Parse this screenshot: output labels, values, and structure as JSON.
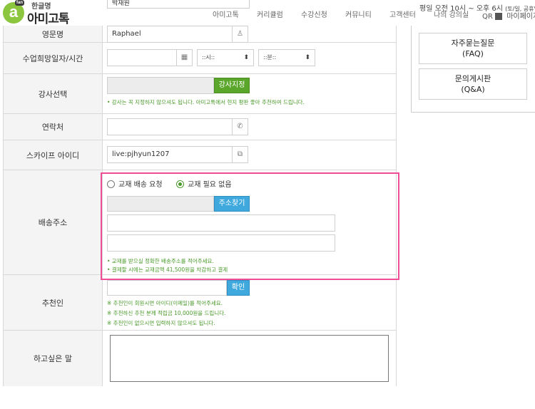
{
  "header": {
    "logo_small": "한글명",
    "logo_main": "아미고톡",
    "logo_badge": "fan",
    "top_name_value": "박재원",
    "nav": [
      "아미고톡",
      "커리큘럼",
      "수강신청",
      "커뮤니티",
      "고객센터",
      "나의 강의실"
    ],
    "hours": "평일 오전 10시 ~ 오후 6시",
    "hours_note": "(토/일, 공휴일 휴무)",
    "mypage": "마이페이지",
    "mypage_prefix": "QR"
  },
  "form": {
    "english_name": {
      "label": "영문명",
      "value": "Raphael",
      "icon": "person-icon"
    },
    "schedule": {
      "label": "수업희망일자/시간",
      "date_value": "",
      "hour_placeholder": "::시::",
      "minute_placeholder": "::분::"
    },
    "teacher": {
      "label": "강사선택",
      "value": "",
      "button": "강사지정",
      "note": "• 강사는 꼭 지정하지 않으셔도 됩니다. 아미고톡에서 현지 평판 좋아 추천하여 드립니다."
    },
    "contact": {
      "label": "연락처",
      "value": ""
    },
    "skype": {
      "label": "스카이프 아이디",
      "value": "live:pjhyun1207"
    },
    "shipping": {
      "label": "배송주소",
      "option_request": "교재 배송 요청",
      "option_none": "교재 필요 없음",
      "selected": "교재 필요 없음",
      "zip_value": "",
      "search_button": "주소찾기",
      "address1": "",
      "address2": "",
      "note1": "• 교재를 받으실 정확한 배송주소를 적어주세요.",
      "note2": "• 결제할 시에는 교재금액 41,500원을 차감하고 결제"
    },
    "referrer": {
      "label": "추천인",
      "value": "",
      "button": "확인",
      "note1": "※ 추천인이 회원시면 아이디(이메일)를 적어주세요.",
      "note2": "※ 추천하신 추천 분께 적립금 10,000원을 드립니다.",
      "note3": "※ 추천인이 없으시면 입력하지 않으셔도 됩니다."
    },
    "message": {
      "label": "하고싶은 말",
      "value": ""
    }
  },
  "side": {
    "faq_title": "자주묻는질문",
    "faq_sub": "(FAQ)",
    "qna_title": "문의게시판",
    "qna_sub": "(Q&A)"
  },
  "colors": {
    "highlight": "#ef4e97",
    "green": "#5aa62b",
    "blue": "#3fa9dd",
    "note": "#4a9a2a"
  }
}
